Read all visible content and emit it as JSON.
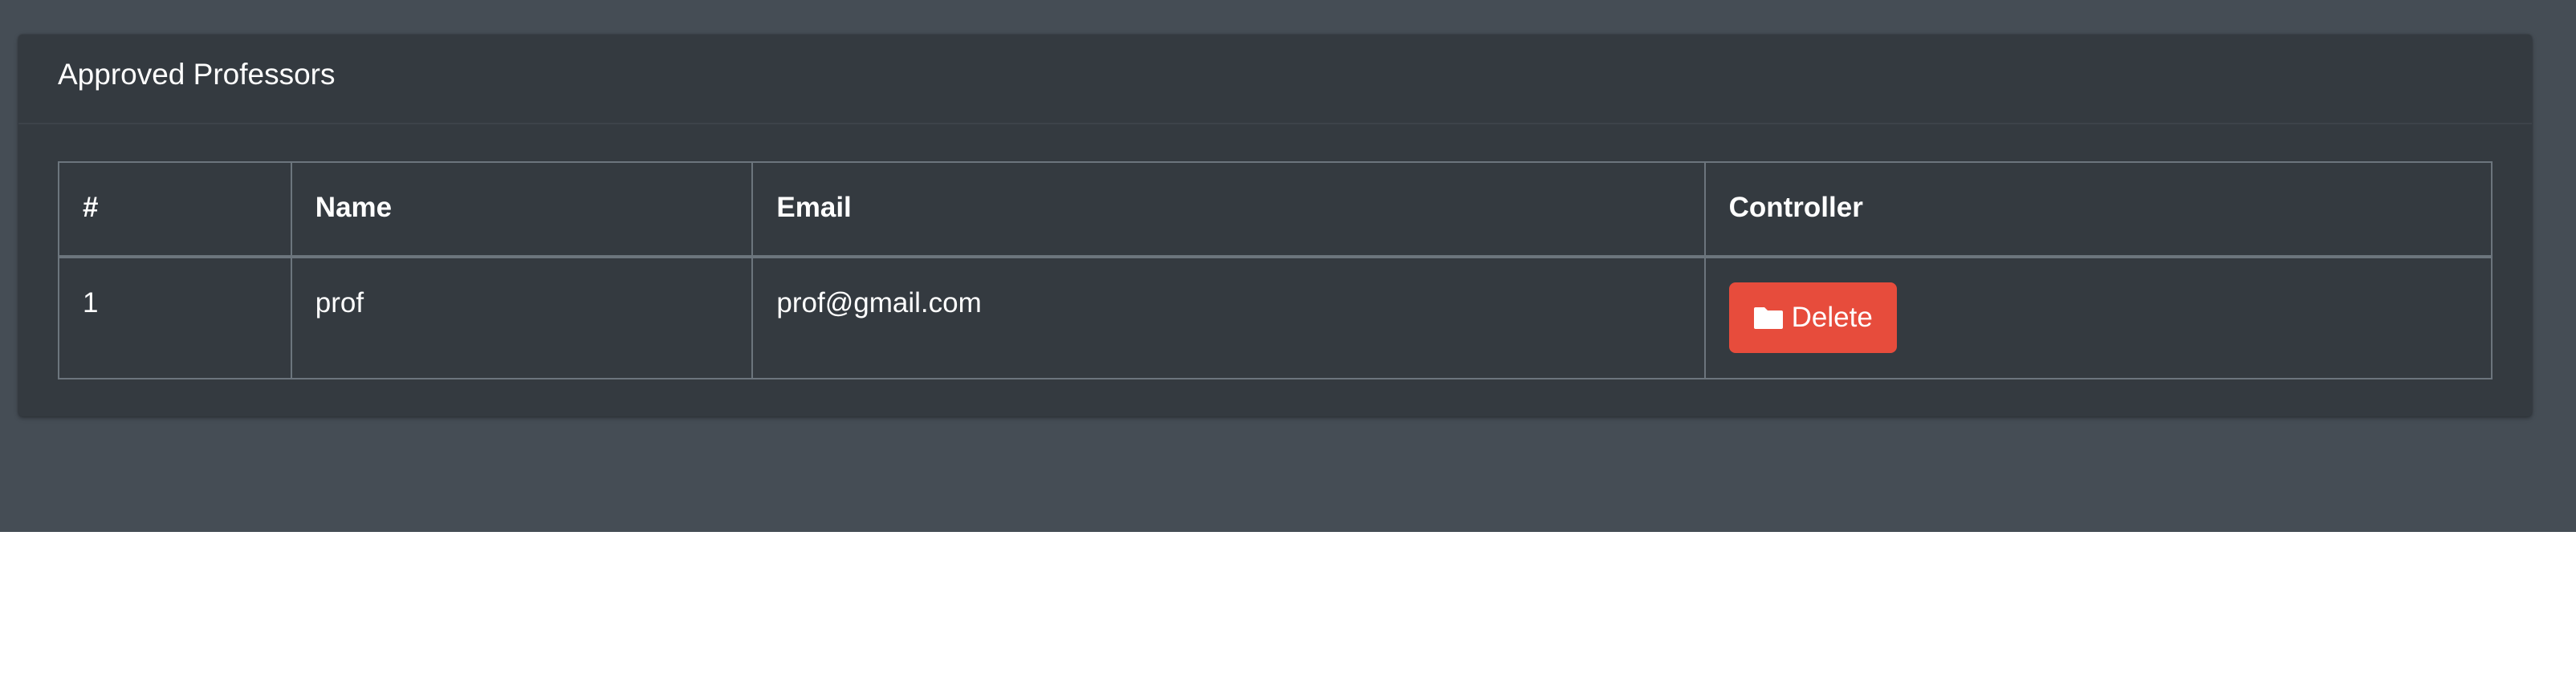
{
  "card": {
    "title": "Approved Professors"
  },
  "table": {
    "headers": [
      "#",
      "Name",
      "Email",
      "Controller"
    ],
    "rows": [
      {
        "num": "1",
        "name": "prof",
        "email": "prof@gmail.com",
        "action_label": "Delete",
        "action_icon": "folder-icon"
      }
    ]
  },
  "colors": {
    "page_background": "#454d55",
    "card_background": "#343a40",
    "delete_button": "#e74c3c"
  }
}
